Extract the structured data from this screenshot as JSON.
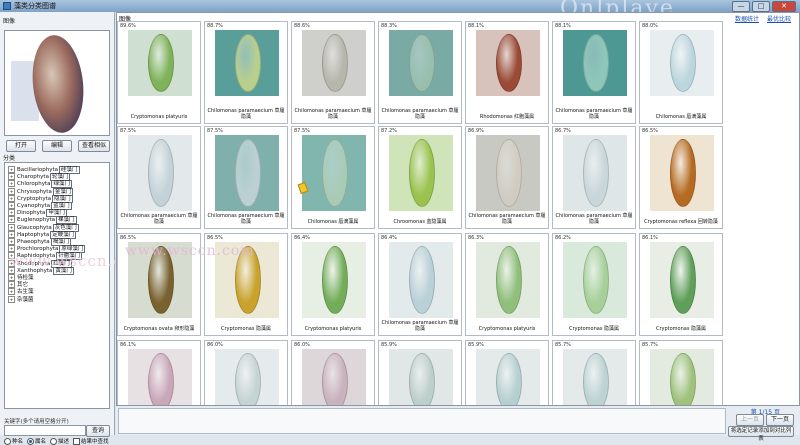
{
  "window": {
    "title": "藻类分类图谱",
    "controls": [
      "—",
      "□",
      "✕"
    ]
  },
  "left": {
    "preview_label": "图像",
    "buttons": {
      "open": "打开",
      "edit": "编辑",
      "view": "查看相似"
    },
    "tree_label": "分类",
    "tree_items": [
      {
        "sign": "+",
        "text": "Bacillariophyta",
        "tag": "硅藻门"
      },
      {
        "sign": "+",
        "text": "Charophyta",
        "tag": "轮藻门"
      },
      {
        "sign": "+",
        "text": "Chlorophyta",
        "tag": "绿藻门"
      },
      {
        "sign": "+",
        "text": "Chrysophyta",
        "tag": "金藻门"
      },
      {
        "sign": "+",
        "text": "Cryptophyta",
        "tag": "隐藻门"
      },
      {
        "sign": "+",
        "text": "Cyanophyta",
        "tag": "蓝藻门"
      },
      {
        "sign": "+",
        "text": "Dinophyta",
        "tag": "甲藻门"
      },
      {
        "sign": "+",
        "text": "Euglenophyta",
        "tag": "裸藻门"
      },
      {
        "sign": "+",
        "text": "Glaucophyta",
        "tag": "灰色藻门"
      },
      {
        "sign": "+",
        "text": "Haptophyta",
        "tag": "定鞭藻门"
      },
      {
        "sign": "+",
        "text": "Phaeophyta",
        "tag": "褐藻门"
      },
      {
        "sign": "+",
        "text": "Prochlorophyta",
        "tag": "原绿藻门"
      },
      {
        "sign": "+",
        "text": "Raphidophyta",
        "tag": "针胞藻门"
      },
      {
        "sign": "+",
        "text": "Rhodophyta",
        "tag": "红藻门"
      },
      {
        "sign": "+",
        "text": "Xanthophyta",
        "tag": "黄藻门"
      },
      {
        "sign": "+",
        "text": "待检藻",
        "tag": ""
      },
      {
        "sign": "+",
        "text": "其它",
        "tag": ""
      },
      {
        "sign": "+",
        "text": "古生藻",
        "tag": ""
      },
      {
        "sign": "+",
        "text": "杂藻菌",
        "tag": ""
      }
    ],
    "keyword_label": "关键字(多个请用空格分开)",
    "search_button": "查询",
    "radios": [
      {
        "label": "种名",
        "checked": false
      },
      {
        "label": "属名",
        "checked": true
      },
      {
        "label": "描述",
        "checked": false
      }
    ],
    "checkbox_label": "结果中查找"
  },
  "grid": {
    "label": "图像",
    "links": [
      "数据统计",
      "最优比较"
    ],
    "cells": [
      {
        "pct": "89.6%",
        "caption": "Cryptomonas platyuris",
        "color": "#7fb25a",
        "bg": "#cfe0d2",
        "tall": false
      },
      {
        "pct": "88.7%",
        "caption": "Chilomonas paramaecium 草履隐藻",
        "color": "#b9cf8e",
        "bg": "#5a9e9a",
        "tall": false
      },
      {
        "pct": "88.6%",
        "caption": "Chilomonas paramaecium 草履隐藻",
        "color": "#b7b6ad",
        "bg": "#cfcfcc",
        "tall": false
      },
      {
        "pct": "88.3%",
        "caption": "Chilomonas paramaecium 草履隐藻",
        "color": "#98bfae",
        "bg": "#79aaa3",
        "tall": false
      },
      {
        "pct": "88.1%",
        "caption": "Rhodomonas 红胞藻属",
        "color": "#9a4a36",
        "bg": "#d7c3bc",
        "tall": false
      },
      {
        "pct": "88.1%",
        "caption": "Chilomonas paramaecium 草履隐藻",
        "color": "#8ec7b9",
        "bg": "#4d9892",
        "tall": false
      },
      {
        "pct": "88.0%",
        "caption": "Chilomonas 唇滴藻属",
        "color": "#bcd6dd",
        "bg": "#e8eef0",
        "tall": false
      },
      {
        "pct": "87.5%",
        "caption": "Chilomonas paramaecium 草履隐藻",
        "color": "#c4d2d7",
        "bg": "#e3e8ea",
        "tall": true
      },
      {
        "pct": "87.5%",
        "caption": "Chilomonas paramaecium 草履隐藻",
        "color": "#bcd0d3",
        "bg": "#7fb0ac",
        "tall": true
      },
      {
        "pct": "87.5%",
        "caption": "Chilomonas 唇滴藻属",
        "color": "#a9cbb6",
        "bg": "#80b6ae",
        "tall": true
      },
      {
        "pct": "87.2%",
        "caption": "Chroomonas 蓝隐藻属",
        "color": "#9bc24f",
        "bg": "#cfe5b9",
        "tall": true
      },
      {
        "pct": "86.9%",
        "caption": "Chilomonas paramaecium 草履隐藻",
        "color": "#d1ccc3",
        "bg": "#c8c9c2",
        "tall": true
      },
      {
        "pct": "86.7%",
        "caption": "Chilomonas paramaecium 草履隐藻",
        "color": "#c9d6da",
        "bg": "#dfe6e8",
        "tall": true
      },
      {
        "pct": "86.5%",
        "caption": "Cryptomonas reflexa 回转隐藻",
        "color": "#b56b22",
        "bg": "#efe3d2",
        "tall": true
      },
      {
        "pct": "86.5%",
        "caption": "Cryptomonas ovata 卵形隐藻",
        "color": "#7a6230",
        "bg": "#d7dcd0",
        "tall": true
      },
      {
        "pct": "86.5%",
        "caption": "Cryptomonas 隐藻属",
        "color": "#c8a22c",
        "bg": "#ece8d6",
        "tall": true
      },
      {
        "pct": "86.4%",
        "caption": "Cryptomonas platyuris",
        "color": "#74ad5a",
        "bg": "#e7efe4",
        "tall": true
      },
      {
        "pct": "86.4%",
        "caption": "Chilomonas paramaecium 草履隐藻",
        "color": "#b8d0d6",
        "bg": "#e3eaec",
        "tall": true
      },
      {
        "pct": "86.3%",
        "caption": "Cryptomonas platyuris",
        "color": "#8fbf7a",
        "bg": "#e2eae0",
        "tall": true
      },
      {
        "pct": "86.2%",
        "caption": "Cryptomonas 隐藻属",
        "color": "#a7cf9a",
        "bg": "#d9e9dc",
        "tall": true
      },
      {
        "pct": "86.1%",
        "caption": "Cryptomonas 隐藻属",
        "color": "#5f9f5a",
        "bg": "#e8eee6",
        "tall": true
      },
      {
        "pct": "86.1%",
        "caption": "",
        "color": "#c9a7b8",
        "bg": "#e8e1e4",
        "tall": false
      },
      {
        "pct": "86.0%",
        "caption": "",
        "color": "#c6d3d4",
        "bg": "#e5ebec",
        "tall": false
      },
      {
        "pct": "86.0%",
        "caption": "",
        "color": "#c9b2bd",
        "bg": "#ddd7da",
        "tall": false
      },
      {
        "pct": "85.9%",
        "caption": "",
        "color": "#bdcfcb",
        "bg": "#e1e7e6",
        "tall": false
      },
      {
        "pct": "85.9%",
        "caption": "",
        "color": "#b6cfd0",
        "bg": "#e4eaea",
        "tall": false
      },
      {
        "pct": "85.7%",
        "caption": "",
        "color": "#bcd2d3",
        "bg": "#e4eaea",
        "tall": false
      },
      {
        "pct": "85.7%",
        "caption": "",
        "color": "#9fc27d",
        "bg": "#e3ebe0",
        "tall": false
      }
    ]
  },
  "watermark": "www.wsccn.com",
  "watermark_top": "Onlplaye",
  "bottom": {
    "page_info": "第 1/15 页",
    "prev": "上一页",
    "next": "下一页",
    "add": "将选定记录添加到对比列表"
  }
}
